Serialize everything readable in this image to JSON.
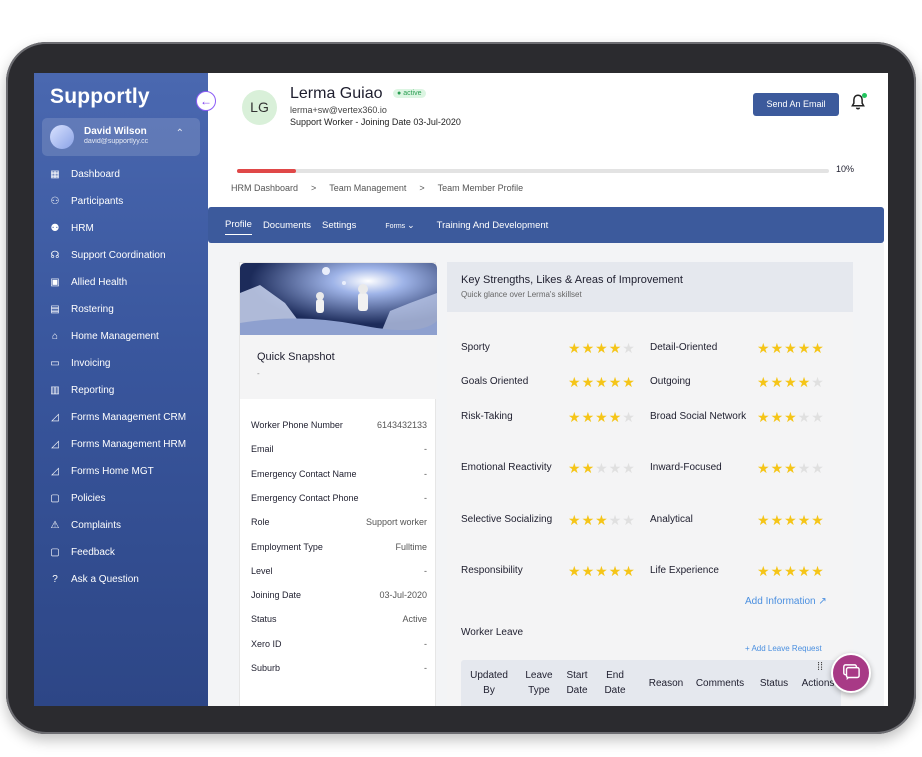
{
  "app": {
    "logo": "Supportly"
  },
  "user": {
    "name": "David Wilson",
    "email": "david@supportlyy.cc"
  },
  "sidebar": {
    "items": [
      {
        "label": "Dashboard",
        "icon": "grid-icon"
      },
      {
        "label": "Participants",
        "icon": "participants-icon"
      },
      {
        "label": "HRM",
        "icon": "people-icon"
      },
      {
        "label": "Support Coordination",
        "icon": "headset-icon"
      },
      {
        "label": "Allied Health",
        "icon": "bag-icon"
      },
      {
        "label": "Rostering",
        "icon": "calendar-icon"
      },
      {
        "label": "Home Management",
        "icon": "home-icon"
      },
      {
        "label": "Invoicing",
        "icon": "invoice-icon"
      },
      {
        "label": "Reporting",
        "icon": "report-icon"
      },
      {
        "label": "Forms Management CRM",
        "icon": "chart-icon"
      },
      {
        "label": "Forms Management HRM",
        "icon": "chart-icon"
      },
      {
        "label": "Forms Home MGT",
        "icon": "chart-icon"
      },
      {
        "label": "Policies",
        "icon": "policies-icon"
      },
      {
        "label": "Complaints",
        "icon": "complaints-icon"
      },
      {
        "label": "Feedback",
        "icon": "feedback-icon"
      },
      {
        "label": "Ask a Question",
        "icon": "question-icon"
      }
    ]
  },
  "employee": {
    "initials": "LG",
    "name": "Lerma Guiao",
    "status": "active",
    "email": "lerma+sw@vertex360.io",
    "role_line": "Support Worker - Joining Date 03-Jul-2020"
  },
  "header": {
    "send_email": "Send An Email"
  },
  "progress": {
    "value": 0.1,
    "label": "10%"
  },
  "breadcrumb": [
    "HRM Dashboard",
    ">",
    "Team Management",
    ">",
    "Team Member Profile"
  ],
  "tabs": [
    "Profile",
    "Documents",
    "Settings",
    "Forms",
    "Training And Development"
  ],
  "snapshot": {
    "title": "Quick Snapshot",
    "subtitle": "-",
    "rows": [
      {
        "label": "Worker Phone Number",
        "value": "6143432133"
      },
      {
        "label": "Email",
        "value": "-"
      },
      {
        "label": "Emergency Contact Name",
        "value": "-"
      },
      {
        "label": "Emergency Contact Phone",
        "value": "-"
      },
      {
        "label": "Role",
        "value": "Support worker"
      },
      {
        "label": "Employment Type",
        "value": "Fulltime"
      },
      {
        "label": "Level",
        "value": "-"
      },
      {
        "label": "Joining Date",
        "value": "03-Jul-2020"
      },
      {
        "label": "Status",
        "value": "Active"
      },
      {
        "label": "Xero ID",
        "value": "-"
      },
      {
        "label": "Suburb",
        "value": "-"
      }
    ]
  },
  "strengths": {
    "title": "Key Strengths, Likes & Areas of Improvement",
    "subtitle": "Quick glance over Lerma's skillset",
    "traits": [
      {
        "left": "Sporty",
        "left_stars": 4,
        "right": "Detail-Oriented",
        "right_stars": 5
      },
      {
        "left": "Goals Oriented",
        "left_stars": 5,
        "right": "Outgoing",
        "right_stars": 4
      },
      {
        "left": "Risk-Taking",
        "left_stars": 4,
        "right": "Broad Social Network",
        "right_stars": 3
      },
      {
        "left": "Emotional Reactivity",
        "left_stars": 2,
        "right": "Inward-Focused",
        "right_stars": 3
      },
      {
        "left": "Selective Socializing",
        "left_stars": 3,
        "right": "Analytical",
        "right_stars": 5
      },
      {
        "left": "Responsibility",
        "left_stars": 5,
        "right": "Life Experience",
        "right_stars": 5
      }
    ],
    "add_info": "Add Information ↗"
  },
  "leave": {
    "title": "Worker Leave",
    "add": "+ Add Leave Request",
    "columns": [
      "Updated By",
      "Leave Type",
      "Start Date",
      "End Date",
      "Reason",
      "Comments",
      "Status",
      "Actions"
    ]
  },
  "colors": {
    "accent": "#3c5a9c",
    "star": "#f5c518",
    "active": "#2a9d52",
    "progress": "#e04848",
    "chat": "#a83a86"
  }
}
